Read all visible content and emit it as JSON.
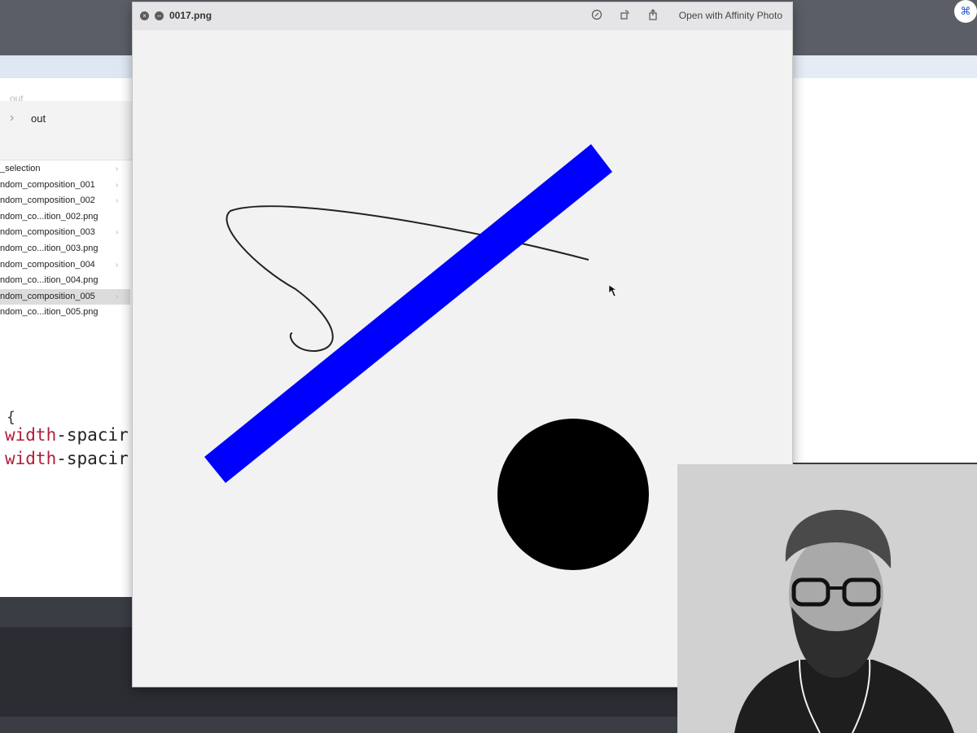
{
  "preview": {
    "title": "0017.png",
    "open_with_label": "Open with Affinity Photo",
    "icons": [
      "close-icon",
      "minimize-icon",
      "markup-icon",
      "rotate-icon",
      "share-icon"
    ],
    "image_colors": {
      "background": "#f2f2f3",
      "bar": "#0000ff",
      "circle": "#000000",
      "curve": "#222222"
    }
  },
  "finder": {
    "ghost_crumb": "out",
    "path_label": "out",
    "items": [
      {
        "label": "_selection",
        "folder": true,
        "selected": false
      },
      {
        "label": "ndom_composition_001",
        "folder": true,
        "selected": false
      },
      {
        "label": "ndom_composition_002",
        "folder": true,
        "selected": false
      },
      {
        "label": "ndom_co...ition_002.png",
        "folder": false,
        "selected": false
      },
      {
        "label": "ndom_composition_003",
        "folder": true,
        "selected": false
      },
      {
        "label": "ndom_co...ition_003.png",
        "folder": false,
        "selected": false
      },
      {
        "label": "ndom_composition_004",
        "folder": true,
        "selected": false
      },
      {
        "label": "ndom_co...ition_004.png",
        "folder": false,
        "selected": false
      },
      {
        "label": "ndom_composition_005",
        "folder": true,
        "selected": true
      },
      {
        "label": "ndom_co...ition_005.png",
        "folder": false,
        "selected": false
      }
    ]
  },
  "editor": {
    "brace": "{",
    "lines": [
      {
        "kw": "width",
        "rest": "-spacir"
      },
      {
        "kw": "width",
        "rest": "-spacir"
      }
    ]
  },
  "system": {
    "top_right_icon": "app-icon"
  }
}
